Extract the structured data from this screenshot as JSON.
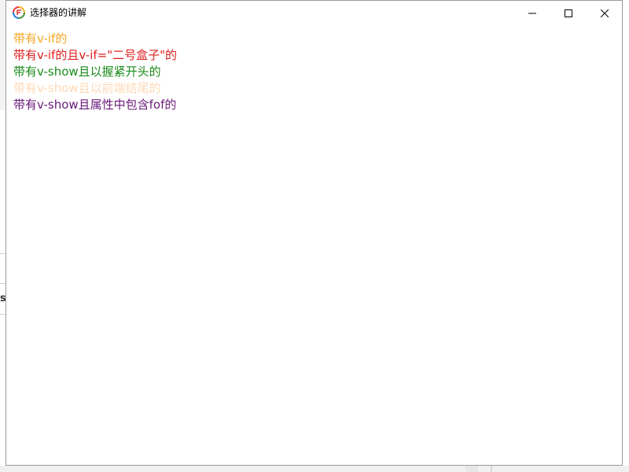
{
  "window": {
    "title": "选择器的讲解",
    "icon": "app-logo-icon",
    "controls": {
      "minimize": "minimize-icon",
      "maximize": "maximize-icon",
      "close": "close-icon"
    }
  },
  "content": {
    "lines": [
      {
        "text": "带有v-if的",
        "color": "#f5a623"
      },
      {
        "text": "带有v-if的且v-if=\"二号盒子\"的",
        "color": "#e02020"
      },
      {
        "text": "带有v-show且以握紧开头的",
        "color": "#1a8a1a"
      },
      {
        "text": "带有v-show且以前端结尾的",
        "color": "#ffd9b8"
      },
      {
        "text": "带有v-show且属性中包含fof的",
        "color": "#6a1a7a"
      }
    ]
  },
  "background": {
    "partial_glyph": "s)"
  }
}
